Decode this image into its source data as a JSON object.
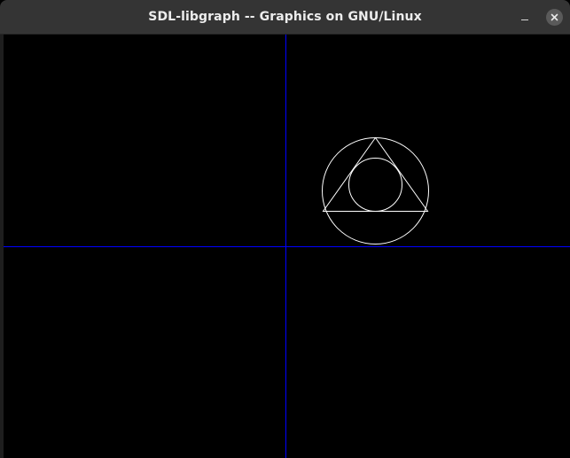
{
  "window": {
    "title": "SDL-libgraph -- Graphics on GNU/Linux",
    "minimize_icon": "minimize-icon",
    "close_icon": "close-icon"
  },
  "canvas": {
    "background": "#000000",
    "axis_color": "#0000ff",
    "shape_color": "#ffffff"
  }
}
